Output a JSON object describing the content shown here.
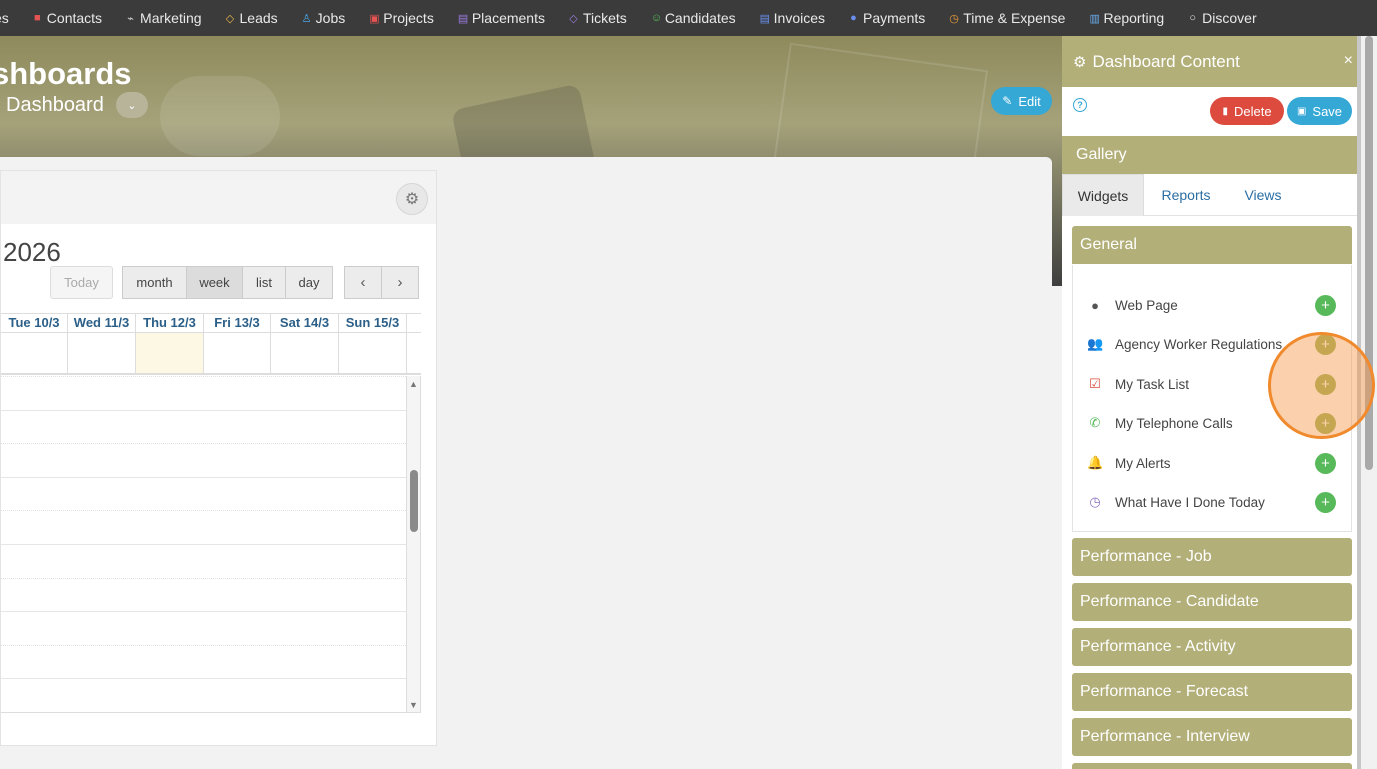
{
  "topnav": {
    "items": [
      {
        "icon": "people-icon",
        "glyph": "",
        "label": "es",
        "color": "#e9e9e9"
      },
      {
        "icon": "contacts-icon",
        "glyph": "■",
        "label": "Contacts",
        "color": "#e55353"
      },
      {
        "icon": "broadcast-icon",
        "glyph": "⌁",
        "label": "Marketing",
        "color": "#cfcfcf"
      },
      {
        "icon": "diamond-icon",
        "glyph": "◇",
        "label": "Leads",
        "color": "#e8b84a"
      },
      {
        "icon": "trophy-icon",
        "glyph": "♙",
        "label": "Jobs",
        "color": "#4aa8e8"
      },
      {
        "icon": "projects-icon",
        "glyph": "▣",
        "label": "Projects",
        "color": "#e55353"
      },
      {
        "icon": "briefcase-icon",
        "glyph": "▤",
        "label": "Placements",
        "color": "#9b7be0"
      },
      {
        "icon": "tag-icon",
        "glyph": "◇",
        "label": "Tickets",
        "color": "#9b7be0"
      },
      {
        "icon": "person-icon",
        "glyph": "☺",
        "label": "Candidates",
        "color": "#58c05a"
      },
      {
        "icon": "invoice-icon",
        "glyph": "▤",
        "label": "Invoices",
        "color": "#6a8ff0"
      },
      {
        "icon": "payments-icon",
        "glyph": "●",
        "label": "Payments",
        "color": "#6a8ff0"
      },
      {
        "icon": "clock-icon",
        "glyph": "◷",
        "label": "Time & Expense",
        "color": "#f0a03a"
      },
      {
        "icon": "bar-chart-icon",
        "glyph": "▥",
        "label": "Reporting",
        "color": "#6aaef0"
      },
      {
        "icon": "search-icon",
        "glyph": "○",
        "label": "Discover",
        "color": "#e9e9e9"
      }
    ]
  },
  "hero": {
    "title": "shboards",
    "subtitle": "Dashboard",
    "edit_label": "Edit"
  },
  "calendar": {
    "title": "2026",
    "today_label": "Today",
    "views": [
      "month",
      "week",
      "list",
      "day"
    ],
    "active_view": "week",
    "prev_glyph": "‹",
    "next_glyph": "›",
    "days": [
      "Tue 10/3",
      "Wed 11/3",
      "Thu 12/3",
      "Fri 13/3",
      "Sat 14/3",
      "Sun 15/3"
    ],
    "today_index": 2
  },
  "panel": {
    "title": "Dashboard Content",
    "close_glyph": "×",
    "help_glyph": "?",
    "delete_label": "Delete",
    "save_label": "Save",
    "gallery_title": "Gallery",
    "tabs": [
      "Widgets",
      "Reports",
      "Views"
    ],
    "active_tab": "Widgets",
    "general_title": "General",
    "widgets": [
      {
        "icon": "globe-icon",
        "glyph": "●",
        "color": "#555555",
        "label": "Web Page"
      },
      {
        "icon": "users-icon",
        "glyph": "👥",
        "color": "#555555",
        "label": "Agency Worker Regulations"
      },
      {
        "icon": "checkbox-icon",
        "glyph": "☑",
        "color": "#dc4b3e",
        "label": "My Task List"
      },
      {
        "icon": "phone-icon",
        "glyph": "✆",
        "color": "#58b95a",
        "label": "My Telephone Calls"
      },
      {
        "icon": "bell-icon",
        "glyph": "🔔",
        "color": "#35a8d6",
        "label": "My Alerts"
      },
      {
        "icon": "clock-icon",
        "glyph": "◷",
        "color": "#8a6fc0",
        "label": "What Have I Done Today"
      }
    ],
    "sections": [
      "Performance - Job",
      "Performance - Candidate",
      "Performance - Activity",
      "Performance - Forecast",
      "Performance - Interview"
    ],
    "add_glyph": "+"
  },
  "colors": {
    "accent_olive": "#b2af79",
    "nav_bg": "#3b3b3b",
    "edit_blue": "#35a8d6",
    "delete_red": "#dc4b3e",
    "add_green": "#58b95a",
    "highlight_orange": "#f08a2c"
  }
}
